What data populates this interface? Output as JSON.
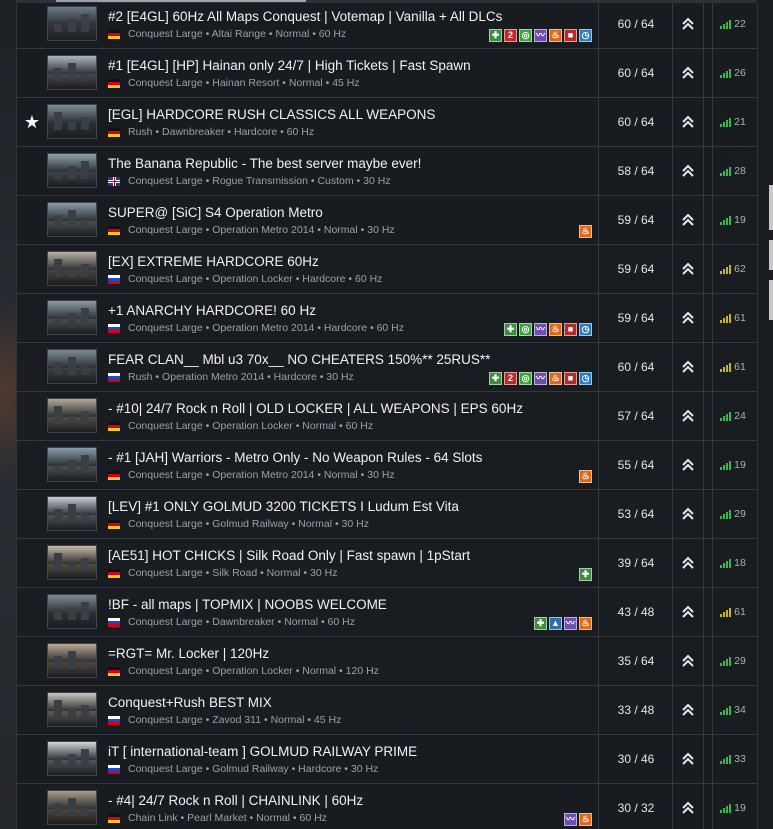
{
  "servers": [
    {
      "name": "#2 [E4GL] 60Hz All Maps Conquest | Votemap | Vanilla + All DLCs",
      "flag": "de",
      "details": "Conquest Large • Altai Range • Normal • 60 Hz",
      "players": "60 / 64",
      "ping": "22",
      "ping_color": "#35b84a",
      "badges": [
        "plus",
        "two",
        "circle",
        "wave",
        "fire",
        "square",
        "clock"
      ],
      "favorite": false
    },
    {
      "name": "#1 [E4GL] [HP] Hainan only 24/7 | High Tickets | Fast Spawn",
      "flag": "de",
      "details": "Conquest Large • Hainan Resort • Normal • 45 Hz",
      "players": "60 / 64",
      "ping": "26",
      "ping_color": "#35b84a",
      "badges": [],
      "favorite": false
    },
    {
      "name": "[EGL] HARDCORE RUSH CLASSICS ALL WEAPONS",
      "flag": "de",
      "details": "Rush • Dawnbreaker • Hardcore • 60 Hz",
      "players": "60 / 64",
      "ping": "21",
      "ping_color": "#35b84a",
      "badges": [],
      "favorite": true,
      "favorite_icon": "★"
    },
    {
      "name": "The Banana Republic - The best server maybe ever!",
      "flag": "gb",
      "details": "Conquest Large • Rogue Transmission • Custom • 30 Hz",
      "players": "58 / 64",
      "ping": "28",
      "ping_color": "#35b84a",
      "badges": [],
      "favorite": false
    },
    {
      "name": "SUPER@ [SiC] S4 Operation Metro",
      "flag": "de",
      "details": "Conquest Large • Operation Metro 2014 • Normal • 30 Hz",
      "players": "59 / 64",
      "ping": "19",
      "ping_color": "#35b84a",
      "badges": [
        "fire"
      ],
      "favorite": false
    },
    {
      "name": "[EX] EXTREME HARDCORE 60Hz",
      "flag": "ru",
      "details": "Conquest Large • Operation Locker • Hardcore • 60 Hz",
      "players": "59 / 64",
      "ping": "62",
      "ping_color": "#c8b521",
      "badges": [],
      "favorite": false
    },
    {
      "name": "+1 ANARCHY HARDCORE! 60 Hz",
      "flag": "ru",
      "details": "Conquest Large • Operation Metro 2014 • Hardcore • 60 Hz",
      "players": "59 / 64",
      "ping": "61",
      "ping_color": "#c8b521",
      "badges": [
        "plus",
        "circle",
        "wave",
        "fire",
        "square",
        "clock"
      ],
      "favorite": false
    },
    {
      "name": "FEAR CLAN__ Mbl u3 70x__ NO CHEATERS 150%** 25RUS**",
      "flag": "ru",
      "details": "Rush • Operation Metro 2014 • Hardcore • 30 Hz",
      "players": "60 / 64",
      "ping": "61",
      "ping_color": "#c8b521",
      "badges": [
        "plus",
        "two",
        "circle",
        "wave",
        "fire",
        "square",
        "clock"
      ],
      "favorite": false
    },
    {
      "name": "- #10| 24/7 Rock n Roll | OLD LOCKER | ALL WEAPONS | EPS 60Hz",
      "flag": "de",
      "details": "Conquest Large • Operation Locker • Normal • 60 Hz",
      "players": "57 / 64",
      "ping": "24",
      "ping_color": "#35b84a",
      "badges": [],
      "favorite": false
    },
    {
      "name": "- #1 [JAH] Warriors - Metro Only - No Weapon Rules - 64 Slots",
      "flag": "de",
      "details": "Conquest Large • Operation Metro 2014 • Normal • 30 Hz",
      "players": "55 / 64",
      "ping": "19",
      "ping_color": "#35b84a",
      "badges": [
        "fire"
      ],
      "favorite": false
    },
    {
      "name": "[LEV] #1 ONLY GOLMUD 3200 TICKETS I Ludum Est Vita",
      "flag": "de",
      "details": "Conquest Large • Golmud Railway • Normal • 30 Hz",
      "players": "53 / 64",
      "ping": "29",
      "ping_color": "#35b84a",
      "badges": [],
      "favorite": false
    },
    {
      "name": "[AE51] HOT CHICKS | Silk Road Only | Fast spawn | 1pStart",
      "flag": "de",
      "details": "Conquest Large • Silk Road • Normal • 30 Hz",
      "players": "39 / 64",
      "ping": "18",
      "ping_color": "#35b84a",
      "badges": [
        "plus"
      ],
      "favorite": false
    },
    {
      "name": "!BF - all maps | TOPMIX | NOOBS WELCOME",
      "flag": "ru",
      "details": "Conquest Large • Dawnbreaker • Normal • 60 Hz",
      "players": "43 / 48",
      "ping": "61",
      "ping_color": "#c8b521",
      "badges": [
        "plus",
        "mtn",
        "wave",
        "fire"
      ],
      "favorite": false
    },
    {
      "name": "=RGT= Mr. Locker | 120Hz",
      "flag": "de",
      "details": "Conquest Large • Operation Locker • Normal • 120 Hz",
      "players": "35 / 64",
      "ping": "29",
      "ping_color": "#35b84a",
      "badges": [],
      "favorite": false
    },
    {
      "name": "Conquest+Rush BEST MIX",
      "flag": "ru",
      "details": "Conquest Large • Zavod 311 • Normal • 45 Hz",
      "players": "33 / 48",
      "ping": "34",
      "ping_color": "#35b84a",
      "badges": [],
      "favorite": false
    },
    {
      "name": "iT [ international-team ] GOLMUD RAILWAY PRIME",
      "flag": "ru",
      "details": "Conquest Large • Golmud Railway • Hardcore • 30 Hz",
      "players": "30 / 46",
      "ping": "33",
      "ping_color": "#35b84a",
      "badges": [],
      "favorite": false
    },
    {
      "name": "- #4| 24/7 Rock n Roll | CHAINLINK | 60Hz",
      "flag": "de",
      "details": "Chain Link • Pearl Market • Normal • 60 Hz",
      "players": "30 / 32",
      "ping": "19",
      "ping_color": "#35b84a",
      "badges": [
        "wave",
        "fire"
      ],
      "favorite": false
    }
  ],
  "badge_styles": {
    "plus": {
      "color": "#3e8d3e",
      "glyph": "✚"
    },
    "two": {
      "color": "#c0282b",
      "glyph": "2"
    },
    "circle": {
      "color": "#3aa63a",
      "glyph": "◎"
    },
    "wave": {
      "color": "#6d4fb0",
      "glyph": "〰"
    },
    "fire": {
      "color": "#dc6a1c",
      "glyph": "♨"
    },
    "square": {
      "color": "#b72a2a",
      "glyph": "■"
    },
    "clock": {
      "color": "#2d7fbf",
      "glyph": "◷"
    },
    "mtn": {
      "color": "#2f6fa8",
      "glyph": "▲"
    }
  },
  "rank_icon": "double-chevron-up-icon",
  "thumb_palettes": [
    [
      "#6c7b86",
      "#3a3633"
    ],
    [
      "#a9b6bd",
      "#4a4b45"
    ],
    [
      "#7c8b95",
      "#2c3035"
    ],
    [
      "#8fa0aa",
      "#3b4148"
    ],
    [
      "#8a9aa6",
      "#4c514d"
    ],
    [
      "#b9b1a2",
      "#4e4438"
    ],
    [
      "#8a9aa6",
      "#4c514d"
    ],
    [
      "#7d8c97",
      "#3d3f40"
    ],
    [
      "#b2a794",
      "#5a4a3b"
    ],
    [
      "#8a9aa6",
      "#4c514d"
    ],
    [
      "#c7cfd4",
      "#4f5358"
    ],
    [
      "#c4b9a6",
      "#5a4b3a"
    ],
    [
      "#7c8b95",
      "#2c3035"
    ],
    [
      "#b9a993",
      "#55473a"
    ],
    [
      "#c9c6bb",
      "#5f5c50"
    ],
    [
      "#cfd4d8",
      "#50565b"
    ],
    [
      "#a89c86",
      "#544736"
    ]
  ]
}
